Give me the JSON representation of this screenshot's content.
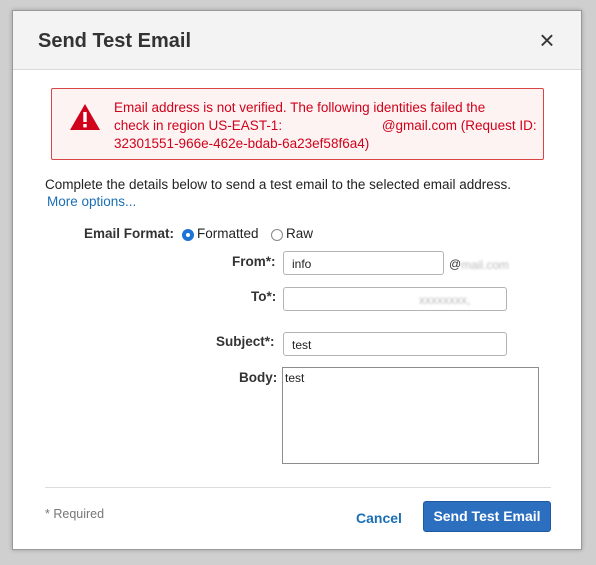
{
  "dialog": {
    "title": "Send Test Email",
    "close_symbol": "×"
  },
  "alert": {
    "icon": "warning-triangle-icon",
    "line1": "Email address is not verified. The following identities failed the",
    "line2_prefix": "check in region US-EAST-1: ",
    "redacted_hint": "xxxxxxxxxxxx",
    "line2_suffix": "@gmail.com (Request ID:",
    "line3": "32301551-966e-462e-bdab-6a23ef58f6a4)",
    "color": "#d0021b"
  },
  "description": "Complete the details below to send a test email to the selected email address.",
  "more_options": "More options...",
  "form": {
    "format_label": "Email Format:",
    "format_formatted": "Formatted",
    "format_raw": "Raw",
    "from_label": "From*:",
    "from_value": "info",
    "from_domain_prefix": "@",
    "from_domain_blurred": "mail.com",
    "to_label": "To*:",
    "to_value_blurred": "xxxxxxxx,",
    "subject_label": "Subject*:",
    "subject_value": "test",
    "body_label": "Body:",
    "body_value": "test"
  },
  "footer": {
    "required_note": "* Required",
    "cancel": "Cancel",
    "send": "Send Test Email"
  },
  "colors": {
    "primary_button": "#2d6fbf",
    "link": "#1a6fb5",
    "radio_selected": "#1e73d6"
  }
}
